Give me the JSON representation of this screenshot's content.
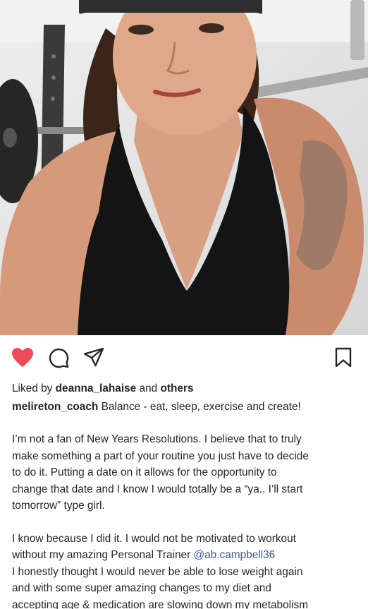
{
  "post": {
    "photo_description": "selfie",
    "likes": {
      "prefix": "Liked by",
      "user": "deanna_lahaise",
      "connector": "and",
      "others": "others"
    },
    "caption": {
      "username": "melireton_coach",
      "headline": "Balance - eat, sleep, exercise and create!"
    },
    "paragraphs": [
      [
        "I’m not a fan of New Years Resolutions. I believe that to truly",
        "make something a part of your routine you just have to decide",
        "to do it. Putting a date on it allows for the opportunity to",
        "change that date and I know I would totally be a “ya.. I’ll start",
        "tomorrow” type girl."
      ],
      [
        "I know because I did it. I would not be motivated to workout",
        "without my amazing Personal Trainer",
        "I honestly thought I would never be able to lose weight again",
        "and with some super amazing changes to my diet and",
        "accepting age & medication are slowing down my metabolism"
      ]
    ],
    "mention": "@ab.campbell36"
  },
  "icons": {
    "like": "heart-filled-icon",
    "comment": "comment-bubble-icon",
    "share": "paper-plane-icon",
    "save": "bookmark-icon"
  },
  "colors": {
    "like": "#ed4956",
    "mention": "#385898",
    "text": "#262626"
  }
}
